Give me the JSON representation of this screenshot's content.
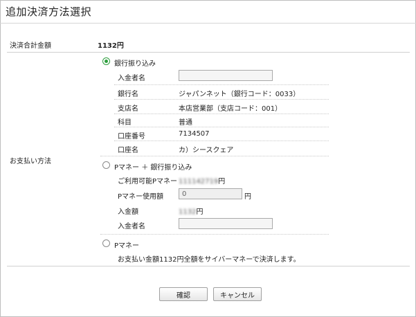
{
  "page": {
    "title": "追加決済方法選択"
  },
  "total": {
    "label": "決済合計金額",
    "value": "1132円"
  },
  "payment": {
    "label": "お支払い方法",
    "options": [
      {
        "label": "銀行振り込み",
        "selected": true,
        "rows": [
          {
            "label": "入金者名",
            "input": ""
          },
          {
            "label": "銀行名",
            "value": "ジャパンネット（銀行コード：0033）"
          },
          {
            "label": "支店名",
            "value": "本店営業部（支店コード：001）"
          },
          {
            "label": "科目",
            "value": "普通"
          },
          {
            "label": "口座番号",
            "value": "7134507"
          },
          {
            "label": "口座名",
            "value": "カ）シースクェア"
          }
        ]
      },
      {
        "label": "Pマネー ＋ 銀行振り込み",
        "selected": false,
        "available_label": "ご利用可能Pマネー",
        "available_value": "111142719",
        "available_unit": "円",
        "use_label": "Pマネー使用額",
        "use_value": "0",
        "use_unit": "円",
        "deposit_label": "入金額",
        "deposit_value": "1132",
        "deposit_unit": "円",
        "name_label": "入金者名",
        "name_input": ""
      },
      {
        "label": "Pマネー",
        "selected": false,
        "note": "お支払い金額1132円全額をサイバーマネーで決済します。"
      }
    ]
  },
  "buttons": {
    "confirm": "確認",
    "cancel": "キャンセル"
  }
}
